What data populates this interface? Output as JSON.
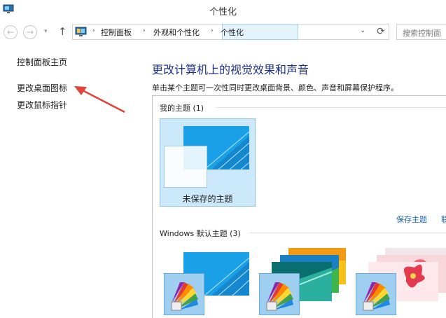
{
  "window": {
    "title": "个性化"
  },
  "nav": {
    "back_glyph": "←",
    "forward_glyph": "→",
    "history_glyph": "▾",
    "up_glyph": "↑",
    "refresh_glyph": "⟳",
    "breadcrumbs": [
      "控制面板",
      "外观和个性化",
      "个性化"
    ],
    "separator": "›",
    "dropdown_glyph": "⌄",
    "search_placeholder": "搜索控制面"
  },
  "left_pane": {
    "links": [
      "控制面板主页",
      "更改桌面图标",
      "更改鼠标指针"
    ]
  },
  "main": {
    "heading": "更改计算机上的视觉效果和声音",
    "subtitle": "单击某个主题可一次性同时更改桌面背景、颜色、声音和屏幕保护程序。",
    "my_themes_label": "我的主题 (1)",
    "selected_theme_name": "未保存的主题",
    "save_theme_link": "保存主题",
    "more_link": "联",
    "windows_themes_label": "Windows 默认主题 (3)"
  },
  "colors": {
    "heading": "#1e3287",
    "link": "#1f66b3",
    "selection_bg": "#cce8fb",
    "selection_border": "#8fc6ec",
    "annotation_arrow": "#e0443b"
  },
  "icons": {
    "app": "personalization-monitor-icon",
    "address": "control-panel-icon",
    "palette": "color-palette-icon"
  }
}
